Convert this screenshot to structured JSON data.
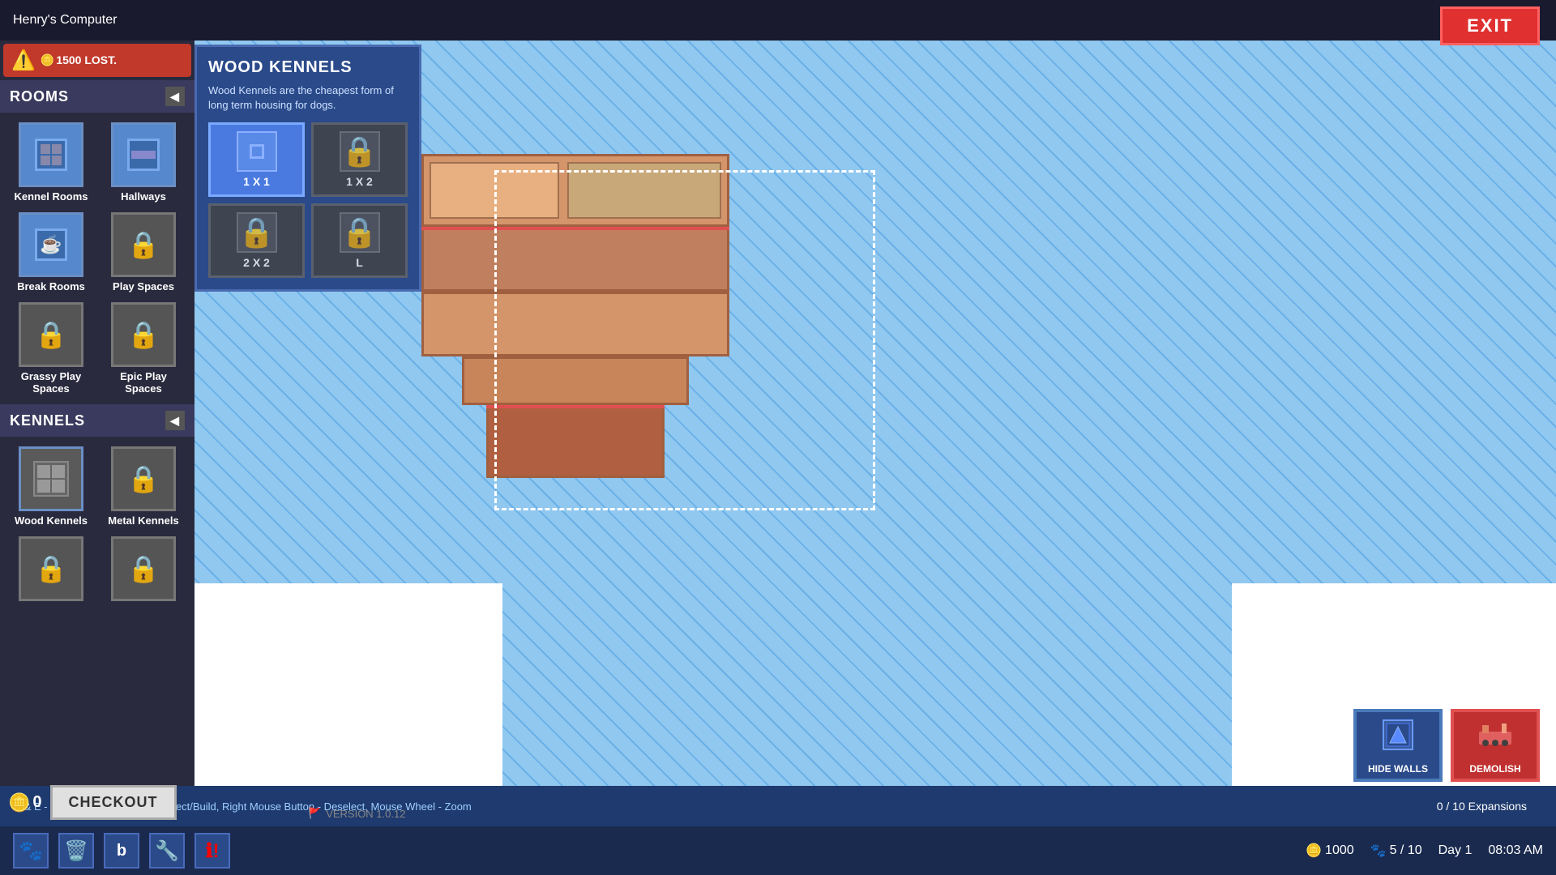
{
  "titleBar": {
    "computerName": "Henry's Computer"
  },
  "exitButton": {
    "label": "EXIT"
  },
  "sidebar": {
    "roomsHeader": "ROOMS",
    "kennelsHeader": "KENNELS",
    "warning": {
      "text": "1500 LOST."
    },
    "rooms": [
      {
        "label": "Kennel Rooms",
        "locked": false,
        "icon": "🏠"
      },
      {
        "label": "Hallways",
        "locked": false,
        "icon": "🏠"
      },
      {
        "label": "Break Rooms",
        "locked": false,
        "icon": "🏠"
      },
      {
        "label": "Play Spaces",
        "locked": true
      },
      {
        "label": "Grassy Play Spaces",
        "locked": true
      },
      {
        "label": "Epic Play Spaces",
        "locked": true
      }
    ],
    "kennels": [
      {
        "label": "Wood Kennels",
        "locked": false,
        "icon": "🏠"
      },
      {
        "label": "Metal Kennels",
        "locked": true
      }
    ]
  },
  "popup": {
    "title": "WOOD KENNELS",
    "description": "Wood Kennels are the cheapest form of long term housing for dogs.",
    "options": [
      {
        "size": "1 X 1",
        "locked": false,
        "selected": true
      },
      {
        "size": "1 X 2",
        "locked": true
      },
      {
        "size": "2 X 2",
        "locked": true
      },
      {
        "size": "L",
        "locked": true
      }
    ]
  },
  "bottomBar": {
    "hint": "Q & E  -  Rotate,   Keypad Enter  -  Select/Build,  Right Mouse Button  -  Deselect, Mouse Wheel  -  Zoom",
    "expansions": "0 / 10  Expansions"
  },
  "actionButtons": {
    "hideWalls": "HIDE WALLS",
    "demolish": "DEMOLISH"
  },
  "checkout": {
    "coins": "0",
    "label": "CHECKOUT"
  },
  "taskbar": {
    "icons": [
      "🐾",
      "🗑️",
      "b",
      "🔧",
      "ℹ️",
      "🚩"
    ],
    "stats": {
      "coins": "1000",
      "dogs": "5 / 10",
      "day": "Day 1",
      "time": "08:03 AM"
    },
    "version": "VERSION 1.0.12"
  }
}
